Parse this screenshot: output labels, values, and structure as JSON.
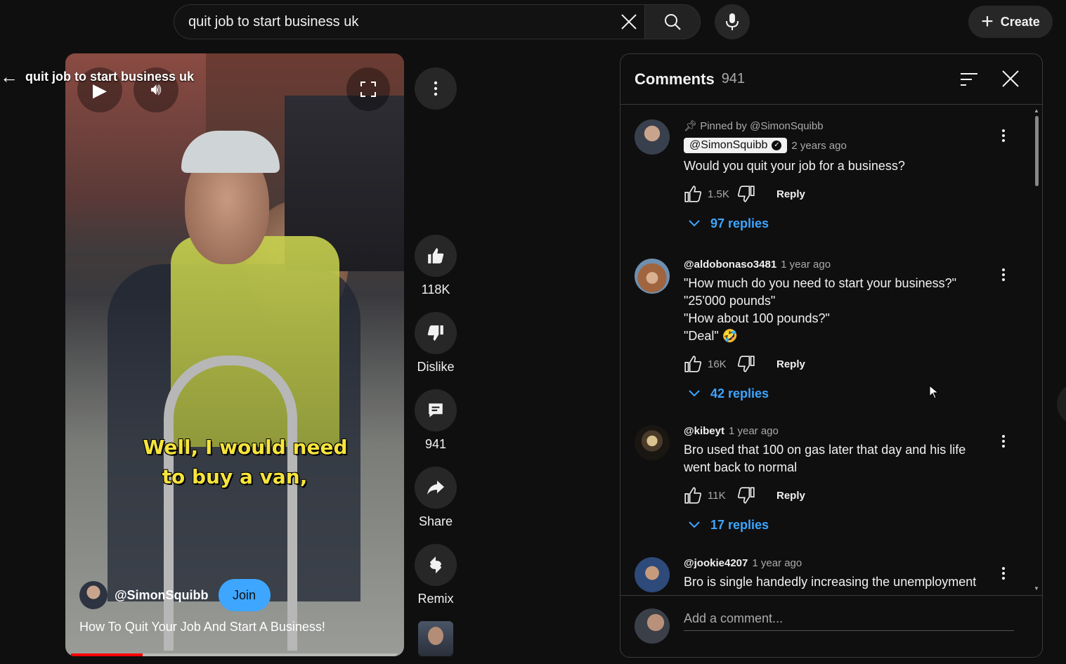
{
  "search": {
    "query": "quit job to start business uk"
  },
  "header": {
    "create_label": "Create"
  },
  "video": {
    "back_title": "quit job to start business uk",
    "caption_line1": "Well, I would need",
    "caption_line2": "to buy a van,",
    "channel": "@SimonSquibb",
    "join_label": "Join",
    "title": "How To Quit Your Job And Start A Business!",
    "progress_fraction": 0.22
  },
  "actions": {
    "likes": "118K",
    "dislike_label": "Dislike",
    "comments": "941",
    "share_label": "Share",
    "remix_label": "Remix"
  },
  "comments_panel": {
    "title": "Comments",
    "count": "941",
    "add_placeholder": "Add a comment...",
    "items": [
      {
        "pinned": "Pinned by @SimonSquibb",
        "author": "@SimonSquibb",
        "time": "2 years ago",
        "text": "Would you quit your job for a business?",
        "likes": "1.5K",
        "reply_label": "Reply",
        "replies": "97 replies"
      },
      {
        "author": "@aldobonaso3481",
        "time": "1 year ago",
        "lines": [
          "\"How much do you need to start your business?\"",
          "\"25'000 pounds\"",
          "\"How about 100 pounds?\"",
          "\"Deal\" 🤣"
        ],
        "likes": "16K",
        "reply_label": "Reply",
        "replies": "42 replies"
      },
      {
        "author": "@kibeyt",
        "time": "1 year ago",
        "lines": [
          "Bro used that 100 on gas later that day and his life",
          "went back to normal"
        ],
        "likes": "11K",
        "reply_label": "Reply",
        "replies": "17 replies"
      },
      {
        "author": "@jookie4207",
        "time": "1 year ago",
        "text": "Bro is single handedly increasing the unemployment"
      }
    ]
  }
}
